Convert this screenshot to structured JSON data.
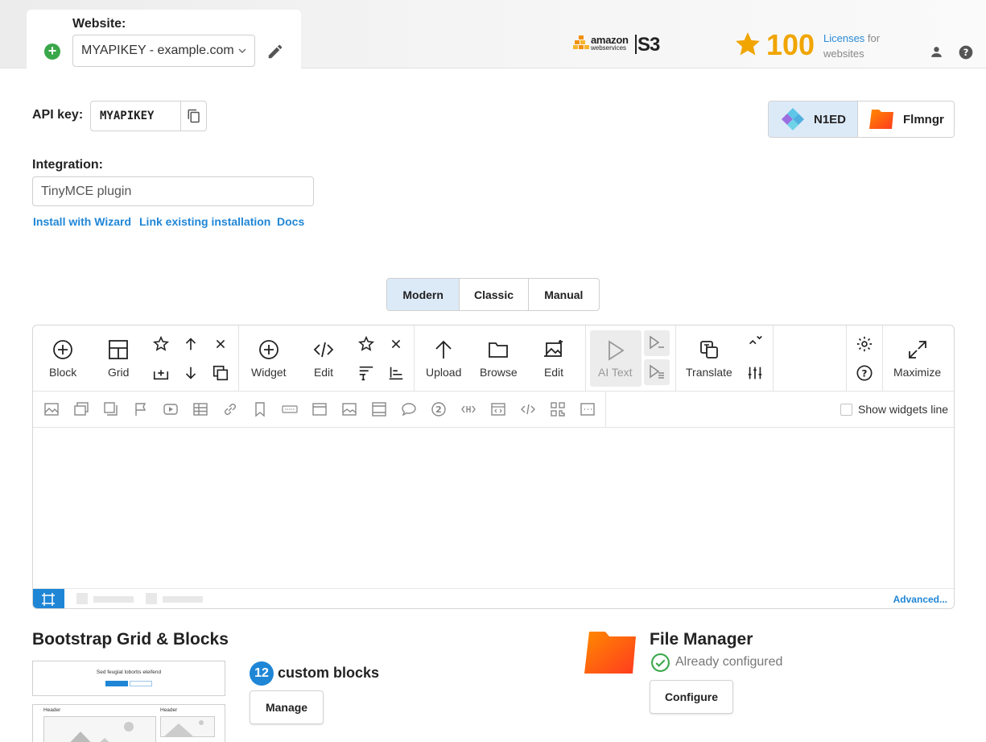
{
  "header": {
    "website_label": "Website:",
    "website_value": "MYAPIKEY - example.com",
    "aws_line1": "amazon",
    "aws_line2": "webservices",
    "aws_s3": "S3",
    "licenses_count": "100",
    "licenses_link": "Licenses",
    "licenses_suffix": " for websites"
  },
  "api": {
    "label": "API key:",
    "value": "MYAPIKEY"
  },
  "products": [
    {
      "label": "N1ED",
      "active": true
    },
    {
      "label": "Flmngr",
      "active": false
    }
  ],
  "integration": {
    "label": "Integration:",
    "value": "TinyMCE plugin",
    "links": [
      "Install with Wizard",
      "Link existing installation",
      "Docs"
    ]
  },
  "modes": [
    {
      "label": "Modern",
      "active": true
    },
    {
      "label": "Classic",
      "active": false
    },
    {
      "label": "Manual",
      "active": false
    }
  ],
  "toolbar": {
    "block": "Block",
    "grid": "Grid",
    "widget": "Widget",
    "edit1": "Edit",
    "upload": "Upload",
    "browse": "Browse",
    "edit2": "Edit",
    "ai_text": "AI Text",
    "translate": "Translate",
    "maximize": "Maximize",
    "show_widgets_line": "Show widgets line",
    "advanced": "Advanced..."
  },
  "bootstrap": {
    "title": "Bootstrap Grid & Blocks",
    "custom_count": "12",
    "custom_label": "custom blocks",
    "manage": "Manage",
    "thumb_heading": "Sed feugiat lobortis eleifend",
    "thumb_header_left": "Header",
    "thumb_header_right": "Header"
  },
  "file_manager": {
    "title": "File Manager",
    "status": "Already configured",
    "configure": "Configure"
  },
  "colors": {
    "accent": "#1f86d6",
    "active_bg": "#dceaf8",
    "star": "#f0a500",
    "success": "#3aa74a"
  }
}
